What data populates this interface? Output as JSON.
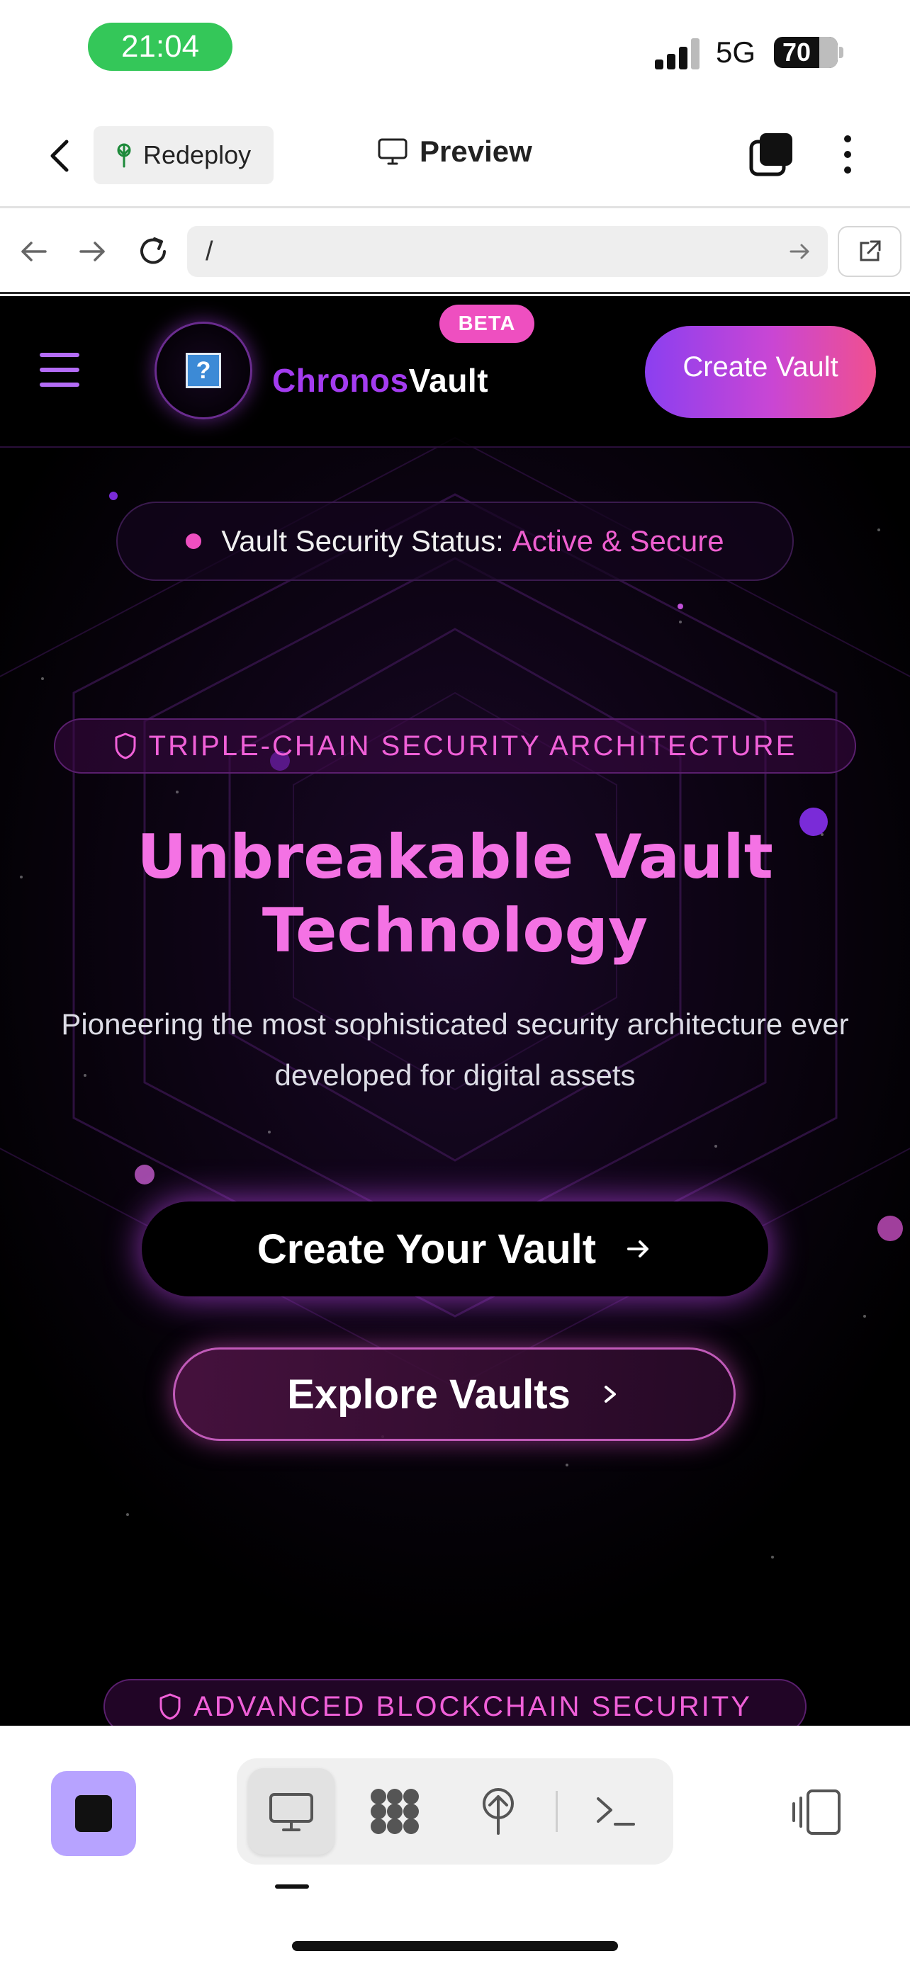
{
  "status_bar": {
    "time": "21:04",
    "network": "5G",
    "battery": "70"
  },
  "toolbar": {
    "redeploy_label": "Redeploy",
    "preview_label": "Preview"
  },
  "url_bar": {
    "path": "/"
  },
  "site": {
    "brand": {
      "part1": "Chronos",
      "part2": "Vault",
      "badge": "BETA",
      "logo_glyph": "?"
    },
    "header_cta": "Create Vault",
    "security_status": {
      "label": "Vault Security Status:",
      "value": "Active & Secure"
    },
    "tag_primary": "TRIPLE-CHAIN SECURITY ARCHITECTURE",
    "hero_title": {
      "line1": "Unbreakable Vault",
      "line2": "Technology"
    },
    "hero_subtitle": "Pioneering the most sophisticated security architecture ever developed for digital assets",
    "primary_button": "Create Your Vault",
    "secondary_button": "Explore Vaults",
    "tag_secondary": "ADVANCED BLOCKCHAIN SECURITY"
  },
  "colors": {
    "accent_pink": "#f472e4",
    "accent_purple": "#a43cf0",
    "status_green": "#34c759",
    "stop_button": "#b7a3ff"
  },
  "icons": {
    "toolbar": [
      "back-chevron-icon",
      "redeploy-icon",
      "monitor-icon",
      "tabs-icon",
      "more-vertical-icon"
    ],
    "url_bar": [
      "arrow-left-icon",
      "arrow-right-icon",
      "reload-icon",
      "go-arrow-icon",
      "open-external-icon"
    ],
    "bottom_bar": [
      "stop-icon",
      "monitor-icon",
      "workspace-icon",
      "deploy-icon",
      "terminal-icon",
      "panels-icon"
    ]
  }
}
